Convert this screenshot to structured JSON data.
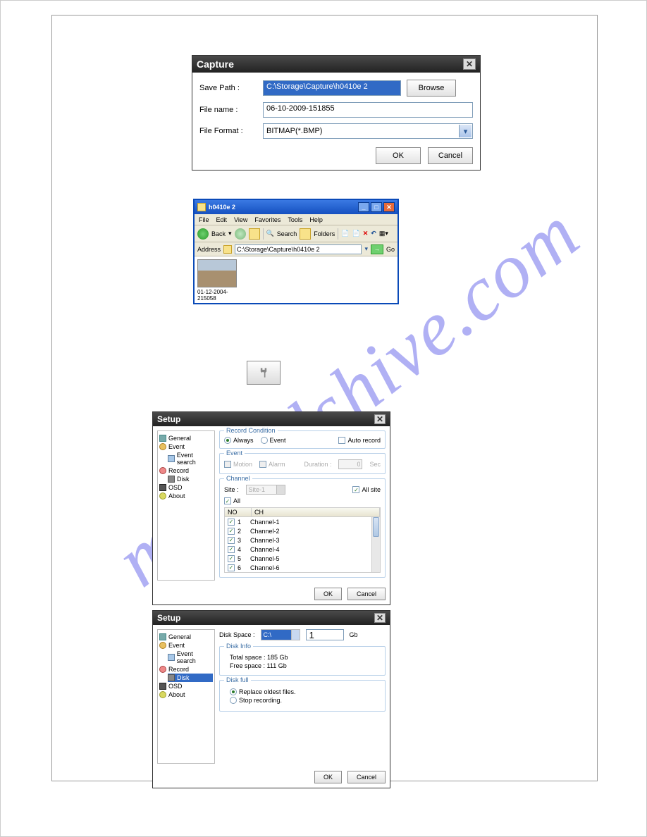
{
  "watermark": "manualshive.com",
  "capture": {
    "title": "Capture",
    "savePathLabel": "Save Path :",
    "savePathValue": "C:\\Storage\\Capture\\h0410e 2",
    "fileNameLabel": "File name :",
    "fileNameValue": "06-10-2009-151855",
    "fileFormatLabel": "File Format :",
    "fileFormatValue": "BITMAP(*.BMP)",
    "browse": "Browse",
    "ok": "OK",
    "cancel": "Cancel"
  },
  "explorer": {
    "title": "h0410e 2",
    "menus": [
      "File",
      "Edit",
      "View",
      "Favorites",
      "Tools",
      "Help"
    ],
    "back": "Back",
    "search": "Search",
    "folders": "Folders",
    "addressLabel": "Address",
    "addressValue": "C:\\Storage\\Capture\\h0410e 2",
    "go": "Go",
    "thumbCaption": "01-12-2004-215058"
  },
  "tree": {
    "general": "General",
    "event": "Event",
    "eventSearch": "Event search",
    "record": "Record",
    "disk": "Disk",
    "osd": "OSD",
    "about": "About"
  },
  "setup1": {
    "title": "Setup",
    "recordCondition": "Record Condition",
    "always": "Always",
    "event": "Event",
    "autoRecord": "Auto record",
    "eventGroup": "Event",
    "motion": "Motion",
    "alarm": "Alarm",
    "duration": "Duration :",
    "durationVal": "0",
    "sec": "Sec",
    "channel": "Channel",
    "site": "Site :",
    "siteVal": "Site-1",
    "allSite": "All site",
    "all": "All",
    "colNo": "NO",
    "colCh": "CH",
    "rows": [
      {
        "no": "1",
        "ch": "Channel-1"
      },
      {
        "no": "2",
        "ch": "Channel-2"
      },
      {
        "no": "3",
        "ch": "Channel-3"
      },
      {
        "no": "4",
        "ch": "Channel-4"
      },
      {
        "no": "5",
        "ch": "Channel-5"
      },
      {
        "no": "6",
        "ch": "Channel-6"
      }
    ],
    "ok": "OK",
    "cancel": "Cancel"
  },
  "setup2": {
    "title": "Setup",
    "diskSpace": "Disk Space :",
    "drive": "C:\\",
    "sizeVal": "1",
    "sizeUnit": "Gb",
    "diskInfo": "Disk Info",
    "total": "Total space : 185 Gb",
    "free": "Free space : 111 Gb",
    "diskFull": "Disk full",
    "replace": "Replace oldest files.",
    "stop": "Stop recording.",
    "ok": "OK",
    "cancel": "Cancel"
  }
}
